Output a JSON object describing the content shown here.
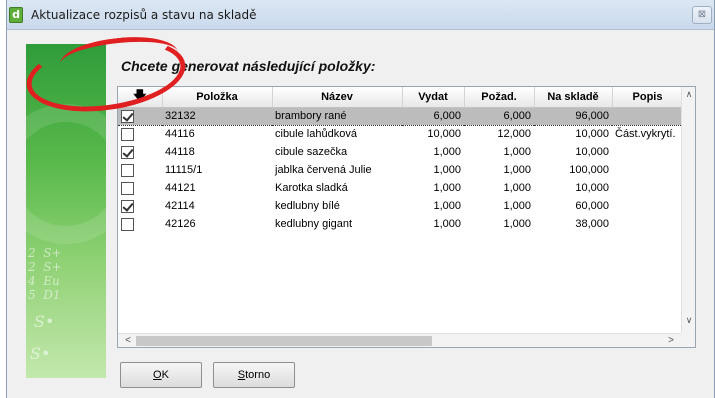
{
  "window": {
    "title": "Aktualizace rozpisů a stavu na skladě",
    "close_symbol": "⊠"
  },
  "prompt": "Chcete generovat následující položky:",
  "columns": [
    "",
    "Položka",
    "Název",
    "Vydat",
    "Požad.",
    "Na skladě",
    "Popis"
  ],
  "rows": [
    {
      "checked": true,
      "selected": true,
      "polozka": "32132",
      "nazev": "brambory rané",
      "vydat": "6,000",
      "pozad": "6,000",
      "na_sklade": "96,000",
      "popis": ""
    },
    {
      "checked": false,
      "selected": false,
      "polozka": "44116",
      "nazev": "cibule lahůdková",
      "vydat": "10,000",
      "pozad": "12,000",
      "na_sklade": "10,000",
      "popis": "Část.vykrytí."
    },
    {
      "checked": true,
      "selected": false,
      "polozka": "44118",
      "nazev": "cibule sazečka",
      "vydat": "1,000",
      "pozad": "1,000",
      "na_sklade": "10,000",
      "popis": ""
    },
    {
      "checked": false,
      "selected": false,
      "polozka": "11115/1",
      "nazev": "jablka červená Julie",
      "vydat": "1,000",
      "pozad": "1,000",
      "na_sklade": "100,000",
      "popis": ""
    },
    {
      "checked": false,
      "selected": false,
      "polozka": "44121",
      "nazev": "Karotka sladká",
      "vydat": "1,000",
      "pozad": "1,000",
      "na_sklade": "10,000",
      "popis": ""
    },
    {
      "checked": true,
      "selected": false,
      "polozka": "42114",
      "nazev": "kedlubny bílé",
      "vydat": "1,000",
      "pozad": "1,000",
      "na_sklade": "60,000",
      "popis": ""
    },
    {
      "checked": false,
      "selected": false,
      "polozka": "42126",
      "nazev": "kedlubny gigant",
      "vydat": "1,000",
      "pozad": "1,000",
      "na_sklade": "38,000",
      "popis": ""
    }
  ],
  "buttons": {
    "ok_mnemonic": "O",
    "ok_rest": "K",
    "cancel_mnemonic": "S",
    "cancel_rest": "torno"
  },
  "side_panel": {
    "formula": "2  S+\n2  S+\n4  Eu\n5  D1",
    "glyph": "S•"
  },
  "colors": {
    "selection": "#bcbcbc",
    "annotation": "#e02020",
    "panel_green": "#58b94a"
  }
}
